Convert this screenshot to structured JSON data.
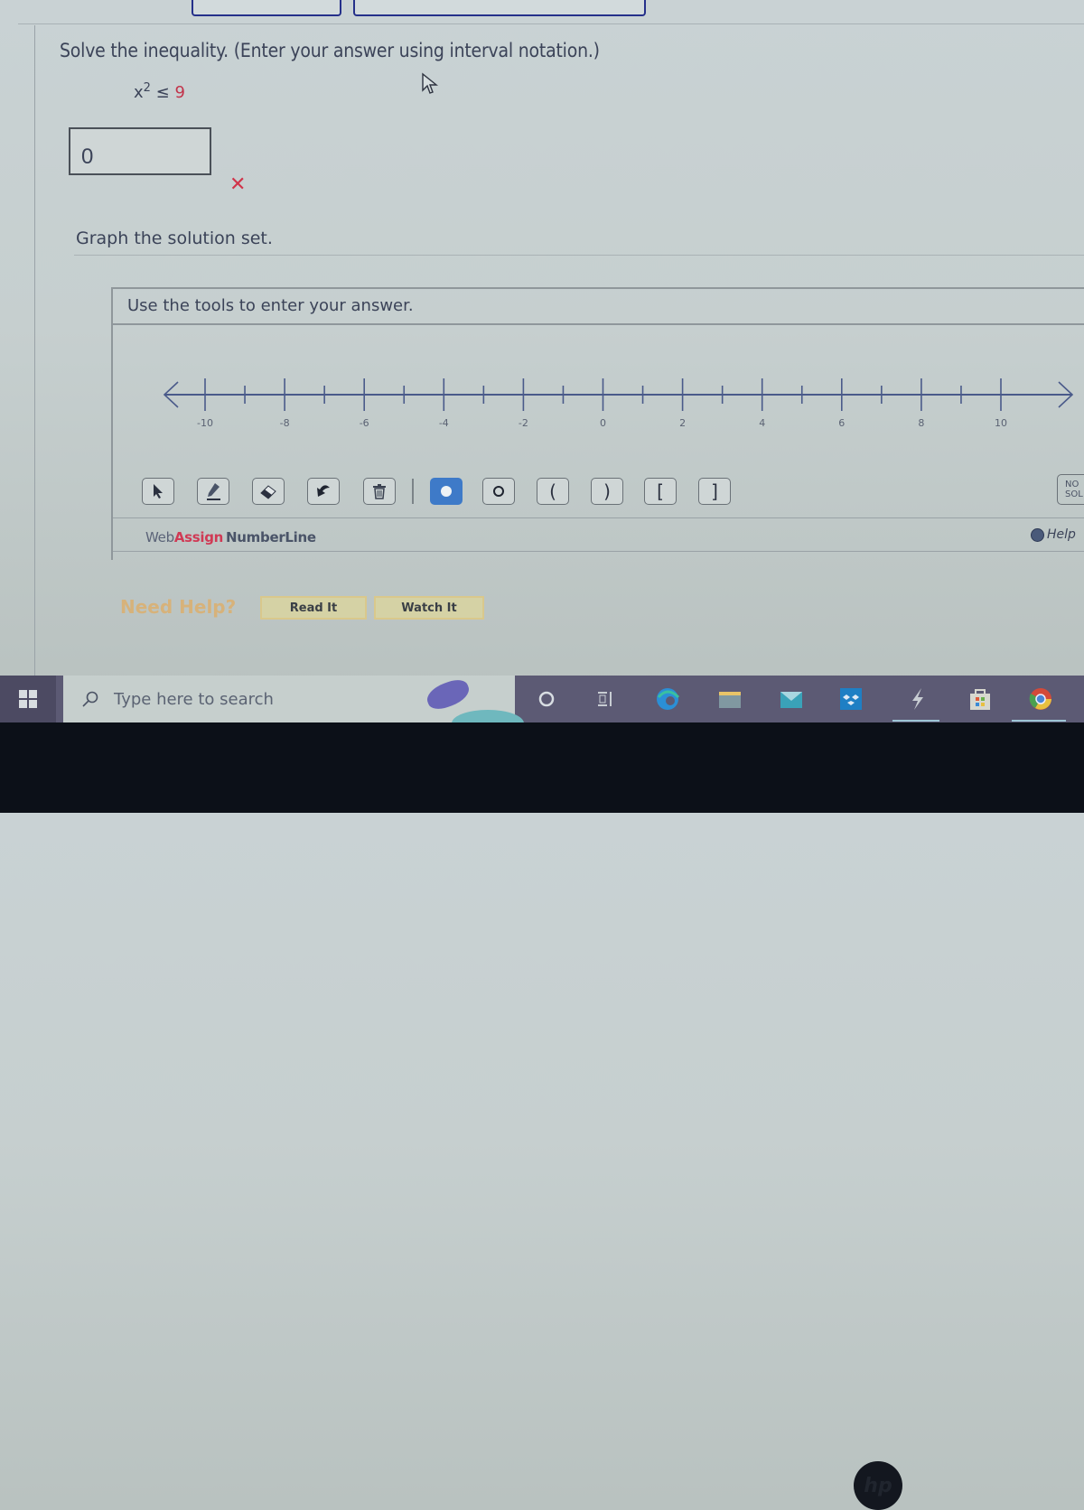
{
  "question": {
    "prompt": "Solve the inequality. (Enter your answer using interval notation.)",
    "inequality_lhs": "x",
    "inequality_exp": "2",
    "inequality_op": "≤",
    "inequality_rhs": "9",
    "answer_value": "0",
    "answer_status": "incorrect",
    "answer_status_icon": "✕",
    "graph_prompt": "Graph the solution set."
  },
  "numberline": {
    "instructions": "Use the tools to enter your answer.",
    "min": -10,
    "max": 10,
    "major_step": 2,
    "minor_step": 1,
    "tick_labels": [
      "-10",
      "-8",
      "-6",
      "-4",
      "-2",
      "0",
      "2",
      "4",
      "6",
      "8",
      "10"
    ],
    "tools": [
      {
        "name": "pointer-tool",
        "icon": "pointer-icon"
      },
      {
        "name": "pencil-tool",
        "icon": "pencil-icon"
      },
      {
        "name": "eraser-tool",
        "icon": "eraser-icon"
      },
      {
        "name": "undo-tool",
        "icon": "undo-icon"
      },
      {
        "name": "delete-tool",
        "icon": "trash-icon"
      },
      {
        "name": "closed-point-tool",
        "icon": "filled-circle-icon",
        "active": true
      },
      {
        "name": "open-point-tool",
        "icon": "open-circle-icon"
      },
      {
        "name": "left-paren-tool",
        "glyph": "("
      },
      {
        "name": "right-paren-tool",
        "glyph": ")"
      },
      {
        "name": "left-bracket-tool",
        "glyph": "["
      },
      {
        "name": "right-bracket-tool",
        "glyph": "]"
      }
    ],
    "no_solution_label_line1": "NO",
    "no_solution_label_line2": "SOL",
    "brand_web": "Web",
    "brand_assign": "Assign",
    "brand_product": "NumberLine",
    "help_label": "Help",
    "accent_color": "#3e7ac8"
  },
  "help": {
    "need_help_label": "Need Help?",
    "read_it_label": "Read It",
    "watch_it_label": "Watch It"
  },
  "taskbar": {
    "search_placeholder": "Type here to search",
    "pinned": [
      "cortana",
      "task-view",
      "edge",
      "file-explorer",
      "mail",
      "dropbox",
      "app-lightning",
      "microsoft-store",
      "chrome"
    ]
  }
}
